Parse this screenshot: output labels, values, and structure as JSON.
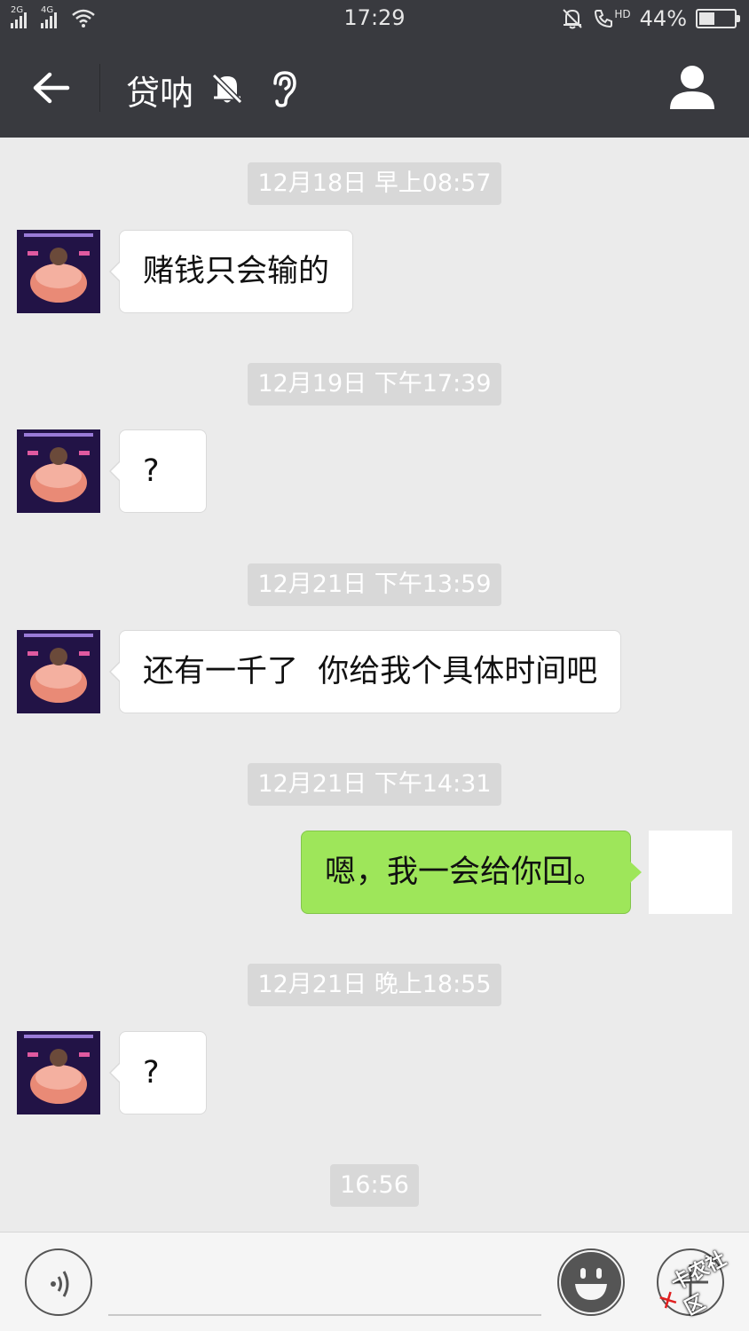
{
  "status_bar": {
    "sim1": "2G",
    "sim2": "4G",
    "time": "17:29",
    "call_badge": "HD",
    "battery": "44%",
    "battery_level": 0.44
  },
  "header": {
    "title": "贷呐",
    "back_icon": "arrow-left-icon",
    "mute_icon": "bell-muted-icon",
    "ear_icon": "ear-icon",
    "profile_icon": "person-icon"
  },
  "messages": [
    {
      "timestamp": "12月18日 早上08:57",
      "direction": "in",
      "text": "赌钱只会输的"
    },
    {
      "timestamp": "12月19日 下午17:39",
      "direction": "in",
      "text": "?"
    },
    {
      "timestamp": "12月21日 下午13:59",
      "direction": "in",
      "text": "还有一千了  你给我个具体时间吧"
    },
    {
      "timestamp": "12月21日 下午14:31",
      "direction": "out",
      "text": "嗯，我一会给你回。"
    },
    {
      "timestamp": "12月21日 晚上18:55",
      "direction": "in",
      "text": "?"
    },
    {
      "timestamp": "16:56"
    }
  ],
  "input_bar": {
    "voice_icon": "voice-icon",
    "emoji_icon": "emoji-icon",
    "plus_icon": "plus-icon",
    "input_value": ""
  },
  "watermark": "卡农社区",
  "colors": {
    "header_bg": "#393a3f",
    "chat_bg": "#ebebeb",
    "outgoing_bubble": "#9ee65a",
    "incoming_bubble": "#ffffff",
    "timestamp_bg": "#d8d8d8"
  }
}
